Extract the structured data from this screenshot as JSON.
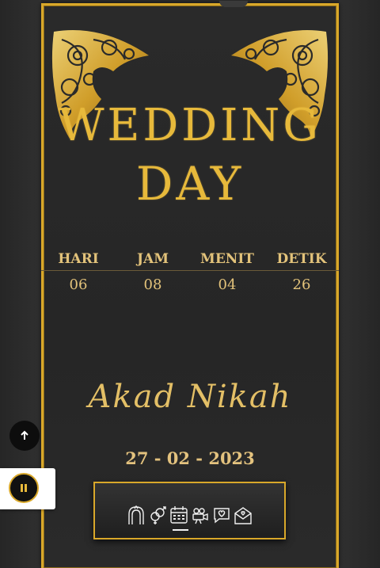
{
  "title": {
    "line1": "WEDDING",
    "line2": "DAY"
  },
  "countdown": [
    {
      "label": "HARI",
      "value": "06"
    },
    {
      "label": "JAM",
      "value": "08"
    },
    {
      "label": "MENIT",
      "value": "04"
    },
    {
      "label": "DETIK",
      "value": "26"
    }
  ],
  "event": {
    "name": "Akad Nikah",
    "date": "27 - 02 - 2023"
  },
  "nav": {
    "icons": [
      "wedding-arch-icon",
      "gender-rings-icon",
      "calendar-icon",
      "video-camera-icon",
      "chat-love-icon",
      "envelope-icon"
    ],
    "active_index": 2
  },
  "controls": {
    "scroll_top_icon": "arrow-up-icon",
    "music_icon": "pause-icon"
  },
  "colors": {
    "gold": "#e7b93b",
    "background": "#2b2b2b",
    "border": "#d9a82a"
  }
}
